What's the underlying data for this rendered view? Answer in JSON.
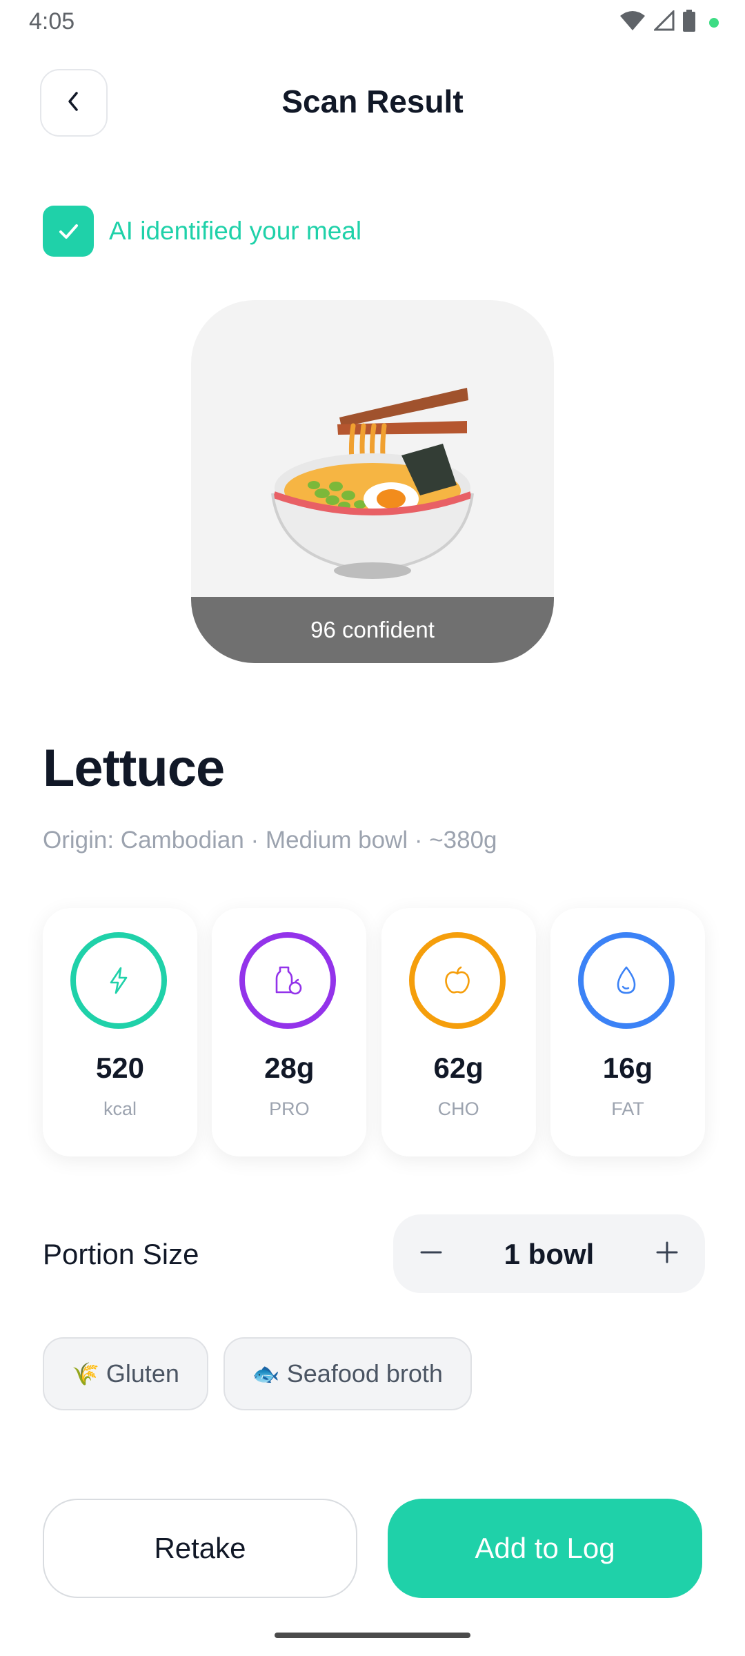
{
  "status_bar": {
    "time": "4:05",
    "icons": [
      "wifi-icon",
      "cellular-icon",
      "battery-icon",
      "privacy-dot-icon"
    ]
  },
  "header": {
    "title": "Scan Result",
    "back_icon": "chevron-left-icon"
  },
  "ai_banner": {
    "text": "AI identified your meal",
    "icon": "check-icon",
    "accent": "#1fd1a9"
  },
  "meal": {
    "image_icon": "ramen-bowl-icon",
    "confidence": "96 confident",
    "name": "Lettuce",
    "meta": "Origin: Cambodian · Medium bowl · ~380g"
  },
  "macros": [
    {
      "value": "520",
      "unit": "kcal",
      "icon": "lightning-icon",
      "color": "#1fd1a9"
    },
    {
      "value": "28g",
      "unit": "PRO",
      "icon": "protein-bottle-icon",
      "color": "#9333ea"
    },
    {
      "value": "62g",
      "unit": "CHO",
      "icon": "apple-icon",
      "color": "#f59e0b"
    },
    {
      "value": "16g",
      "unit": "FAT",
      "icon": "droplet-icon",
      "color": "#3b82f6"
    }
  ],
  "portion": {
    "label": "Portion Size",
    "value": "1 bowl",
    "minus_icon": "minus-icon",
    "plus_icon": "plus-icon"
  },
  "tags": [
    {
      "label": "Gluten",
      "emoji": "🌾",
      "icon": "wheat-icon"
    },
    {
      "label": "Seafood broth",
      "emoji": "🐟",
      "icon": "fish-icon"
    }
  ],
  "actions": {
    "retake": "Retake",
    "add": "Add to Log"
  }
}
